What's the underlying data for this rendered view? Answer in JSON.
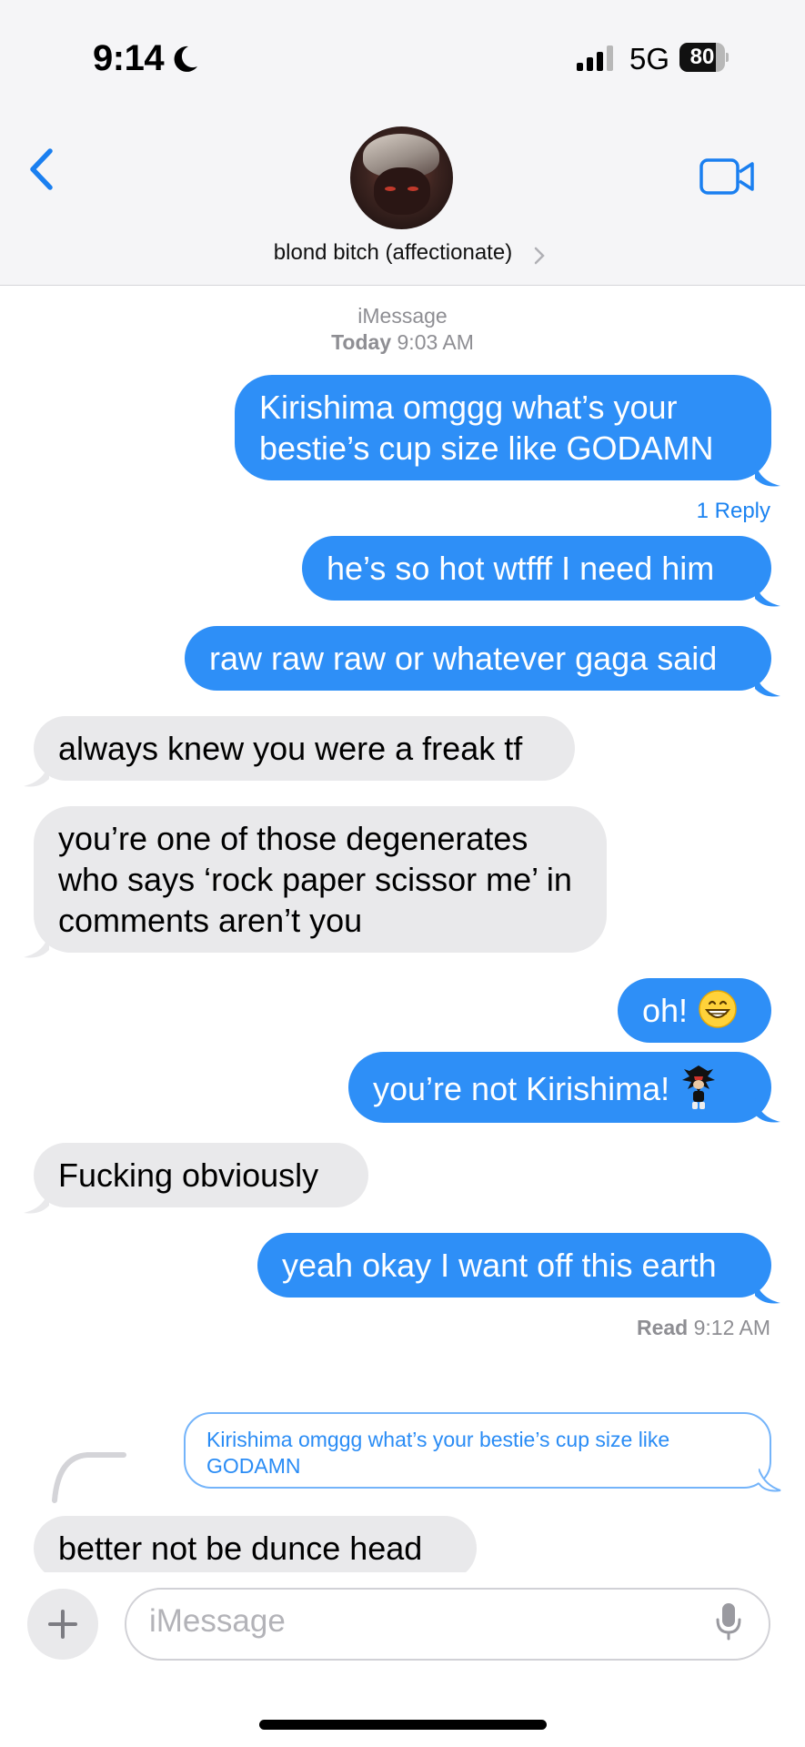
{
  "status_bar": {
    "time": "9:14",
    "network": "5G",
    "battery": "80",
    "battery_level": 0.8
  },
  "header": {
    "contact_name": "blond bitch (affectionate)"
  },
  "conversation": {
    "service": "iMessage",
    "date_label": "Today",
    "date_time": "9:03 AM",
    "messages": [
      {
        "dir": "out",
        "text": "Kirishima omggg what’s your bestie’s cup size like GODAMN"
      },
      {
        "dir": "out",
        "text": "he’s so hot wtfff I need him"
      },
      {
        "dir": "out",
        "text": "raw raw raw or whatever gaga said"
      },
      {
        "dir": "in",
        "text": "always knew you were a freak tf"
      },
      {
        "dir": "in",
        "text": "you’re one of those degenerates who says ‘rock paper scissor me’ in comments aren’t you"
      },
      {
        "dir": "out",
        "text": "oh!"
      },
      {
        "dir": "out",
        "text": "you’re not Kirishima!"
      },
      {
        "dir": "in",
        "text": "Fucking obviously"
      },
      {
        "dir": "out",
        "text": "yeah okay I want off this earth"
      },
      {
        "dir": "in",
        "text": "better not be dunce head"
      }
    ],
    "reply_count": "1 Reply",
    "read_label": "Read",
    "read_time": "9:12 AM",
    "quoted_text": "Kirishima omggg what’s your bestie’s cup size like GODAMN"
  },
  "composer": {
    "placeholder": "iMessage"
  },
  "colors": {
    "outgoing": "#2e8ff7",
    "incoming": "#e9e9eb",
    "link": "#1b83f1"
  }
}
